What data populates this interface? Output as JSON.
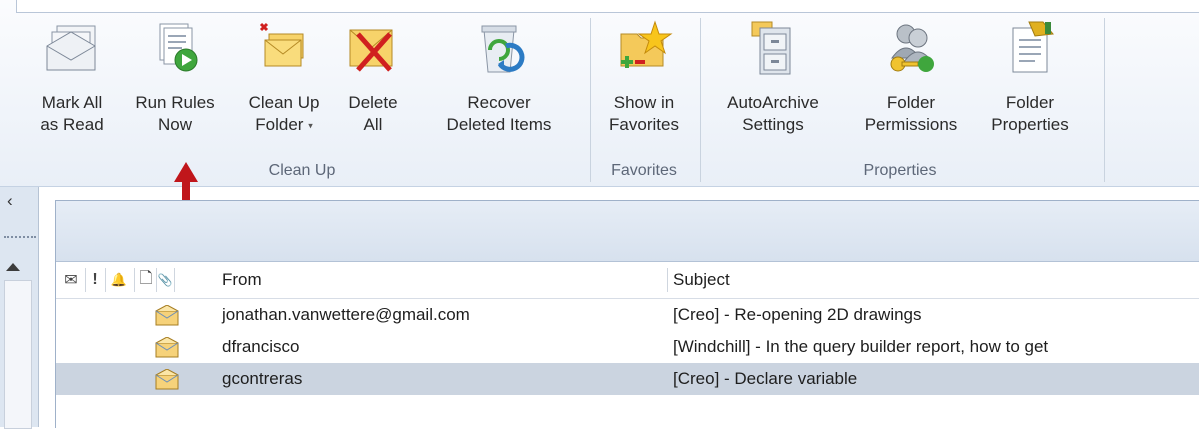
{
  "ribbon": {
    "groups": [
      {
        "label": "Clean Up",
        "buttons": [
          {
            "line1": "Mark All",
            "line2": "as Read",
            "icon": "mark-all-read-icon"
          },
          {
            "line1": "Run Rules",
            "line2": "Now",
            "icon": "run-rules-icon"
          },
          {
            "line1": "Clean Up",
            "line2": "Folder",
            "dropdown": "▾",
            "icon": "clean-up-folder-icon"
          },
          {
            "line1": "Delete",
            "line2": "All",
            "icon": "delete-all-icon"
          },
          {
            "line1": "Recover",
            "line2": "Deleted Items",
            "icon": "recover-deleted-icon"
          }
        ]
      },
      {
        "label": "Favorites",
        "buttons": [
          {
            "line1": "Show in",
            "line2": "Favorites",
            "icon": "show-in-favorites-icon"
          }
        ]
      },
      {
        "label": "Properties",
        "buttons": [
          {
            "line1": "AutoArchive",
            "line2": "Settings",
            "icon": "autoarchive-icon"
          },
          {
            "line1": "Folder",
            "line2": "Permissions",
            "icon": "folder-permissions-icon"
          },
          {
            "line1": "Folder",
            "line2": "Properties",
            "icon": "folder-properties-icon"
          }
        ]
      }
    ]
  },
  "nav": {
    "collapse_glyph": "‹"
  },
  "message_list": {
    "columns": {
      "icon_glyphs": [
        "✉",
        "!",
        "🔔",
        "🗋",
        "📎"
      ],
      "from": "From",
      "subject": "Subject"
    },
    "rows": [
      {
        "from": "jonathan.vanwettere@gmail.com",
        "subject": "[Creo] - Re-opening 2D drawings",
        "selected": false
      },
      {
        "from": "dfrancisco",
        "subject": "[Windchill] - In the query builder report, how to get",
        "selected": false
      },
      {
        "from": "gcontreras",
        "subject": "[Creo] - Declare variable",
        "selected": true
      }
    ]
  },
  "colors": {
    "annotation_arrow": "#c0161b",
    "selected_row": "#cbd4e0"
  }
}
